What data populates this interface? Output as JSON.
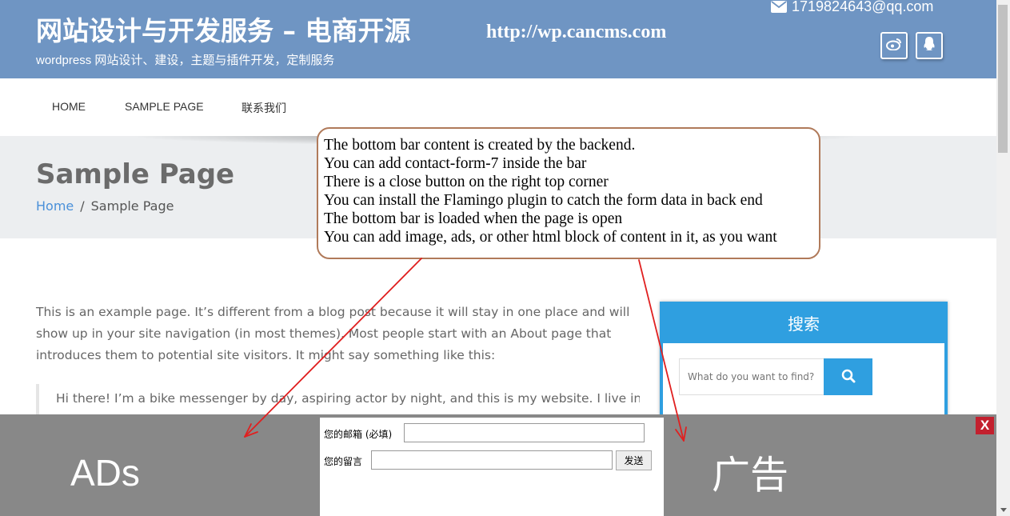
{
  "header": {
    "site_title": "网站设计与开发服务 – 电商开源",
    "site_url": "http://wp.cancms.com",
    "tagline": "wordpress 网站设计、建设，主题与插件开发，定制服务",
    "email": "1719824643@qq.com",
    "social": [
      "weibo-icon",
      "qq-icon"
    ]
  },
  "nav": {
    "items": [
      "HOME",
      "SAMPLE PAGE",
      "联系我们"
    ]
  },
  "page": {
    "title": "Sample Page",
    "breadcrumb_home": "Home",
    "breadcrumb_sep": "/",
    "breadcrumb_current": "Sample Page"
  },
  "content": {
    "paragraph": "This is an example page. It’s different from a blog post because it will stay in one place and will show up in your site navigation (in most themes). Most people start with an About page that introduces them to potential site visitors. It might say something like this:",
    "quote": "Hi there! I’m a bike messenger by day, aspiring actor by night, and this is my website. I live in"
  },
  "sidebar": {
    "widget_title": "搜索",
    "search_placeholder": "What do you want to find?"
  },
  "callout": {
    "lines": [
      "The bottom bar content is created by the backend.",
      "You can add contact-form-7 inside the bar",
      "There is a close button on the right top corner",
      "You can install the Flamingo plugin to catch the form data in back end",
      "The bottom bar is loaded when the page is open",
      "You can add image, ads, or other html block of content in it, as you want"
    ]
  },
  "bottom_bar": {
    "ads_left": "ADs",
    "ads_right": "广告",
    "close_label": "X",
    "email_label": "您的邮箱 (必填)",
    "message_label": "您的留言",
    "send_label": "发送"
  },
  "colors": {
    "header_bg": "#6f95c3",
    "accent_blue": "#2f9fe0",
    "bottom_bar_bg": "#888888",
    "close_red": "#c3202e",
    "arrow_red": "#e02020"
  }
}
